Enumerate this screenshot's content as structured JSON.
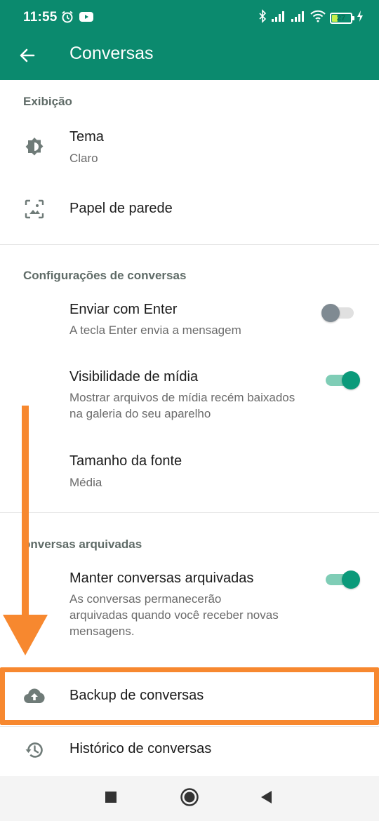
{
  "status_bar": {
    "time": "11:55",
    "battery": "27",
    "battery_level": 0.27,
    "icons": [
      "alarm-icon",
      "youtube-icon",
      "bluetooth-icon",
      "signal-icon",
      "signal-icon",
      "wifi-icon",
      "battery-icon",
      "charging-icon"
    ]
  },
  "app_bar": {
    "title": "Conversas",
    "back_icon": "arrow-back-icon"
  },
  "sections": {
    "display": {
      "header": "Exibição",
      "theme": {
        "title": "Tema",
        "subtitle": "Claro",
        "icon": "brightness-icon"
      },
      "wallpaper": {
        "title": "Papel de parede",
        "icon": "wallpaper-icon"
      }
    },
    "chat_settings": {
      "header": "Configurações de conversas",
      "enter_send": {
        "title": "Enviar com Enter",
        "subtitle": "A tecla Enter envia a mensagem",
        "enabled": false
      },
      "media_visibility": {
        "title": "Visibilidade de mídia",
        "subtitle": "Mostrar arquivos de mídia recém baixados na galeria do seu aparelho",
        "enabled": true
      },
      "font_size": {
        "title": "Tamanho da fonte",
        "subtitle": "Média"
      }
    },
    "archived": {
      "header": "onversas arquivadas",
      "keep_archived": {
        "title": "Manter conversas arquivadas",
        "subtitle": "As conversas permanecerão arquivadas quando você receber novas mensagens.",
        "enabled": true
      }
    },
    "backup": {
      "title": "Backup de conversas",
      "icon": "cloud-upload-icon"
    },
    "history": {
      "title": "Histórico de conversas",
      "icon": "history-icon"
    }
  },
  "colors": {
    "primary": "#0b8a6e",
    "accent": "#0b9a7a",
    "annotation": "#f7882f"
  },
  "nav_bar": {
    "icons": [
      "recents-square-icon",
      "home-circle-icon",
      "back-triangle-icon"
    ]
  }
}
